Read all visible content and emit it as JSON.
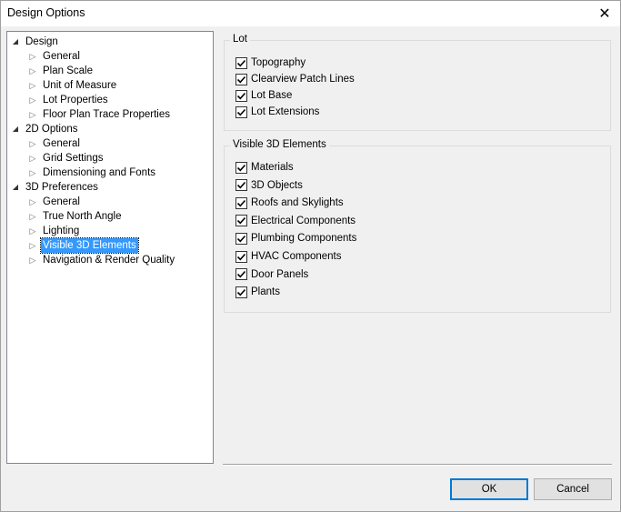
{
  "window": {
    "title": "Design Options",
    "close_icon": "close-icon"
  },
  "tree": {
    "items": [
      {
        "label": "Design",
        "level": 0,
        "expanded": true
      },
      {
        "label": "General",
        "level": 1
      },
      {
        "label": "Plan Scale",
        "level": 1
      },
      {
        "label": "Unit of Measure",
        "level": 1
      },
      {
        "label": "Lot Properties",
        "level": 1
      },
      {
        "label": "Floor Plan Trace Properties",
        "level": 1
      },
      {
        "label": "2D Options",
        "level": 0,
        "expanded": true
      },
      {
        "label": "General",
        "level": 1
      },
      {
        "label": "Grid Settings",
        "level": 1
      },
      {
        "label": "Dimensioning and Fonts",
        "level": 1
      },
      {
        "label": "3D Preferences",
        "level": 0,
        "expanded": true
      },
      {
        "label": "General",
        "level": 1
      },
      {
        "label": "True North Angle",
        "level": 1
      },
      {
        "label": "Lighting",
        "level": 1
      },
      {
        "label": "Visible 3D Elements",
        "level": 1,
        "selected": true
      },
      {
        "label": "Navigation & Render Quality",
        "level": 1
      }
    ]
  },
  "lot_group": {
    "title": "Lot",
    "options": [
      {
        "label": "Topography",
        "checked": true
      },
      {
        "label": "Clearview Patch Lines",
        "checked": true
      },
      {
        "label": "Lot Base",
        "checked": true
      },
      {
        "label": "Lot Extensions",
        "checked": true
      }
    ]
  },
  "visible_group": {
    "title": "Visible 3D Elements",
    "options": [
      {
        "label": "Materials",
        "checked": true
      },
      {
        "label": "3D Objects",
        "checked": true
      },
      {
        "label": "Roofs and Skylights",
        "checked": true
      },
      {
        "label": "Electrical Components",
        "checked": true
      },
      {
        "label": "Plumbing Components",
        "checked": true
      },
      {
        "label": "HVAC Components",
        "checked": true
      },
      {
        "label": "Door Panels",
        "checked": true
      },
      {
        "label": "Plants",
        "checked": true
      }
    ]
  },
  "buttons": {
    "ok": "OK",
    "cancel": "Cancel"
  },
  "colors": {
    "selection": "#3399ff",
    "default_button_border": "#0078d7"
  }
}
